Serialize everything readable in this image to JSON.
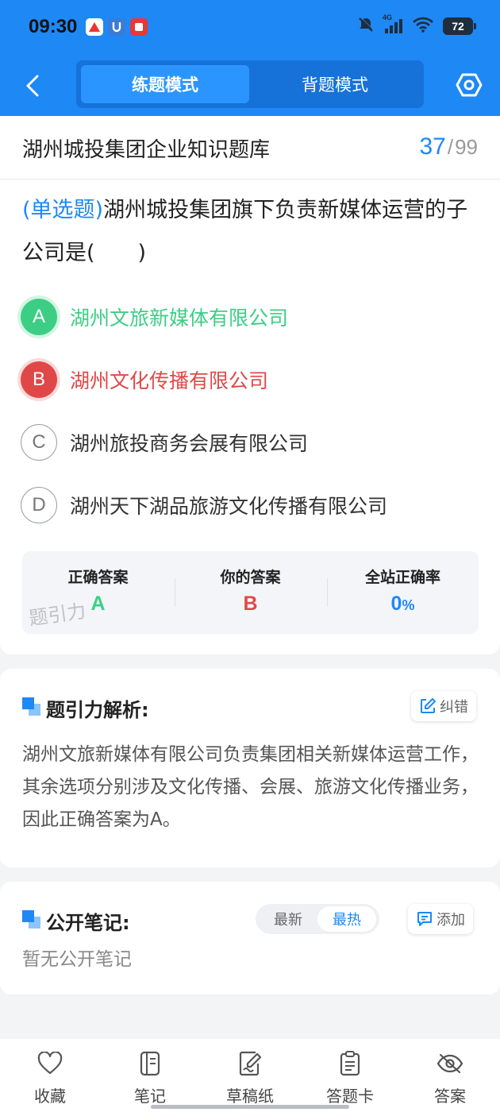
{
  "status_bar": {
    "time": "09:30",
    "network": "4G",
    "battery": "72"
  },
  "nav": {
    "mode_practice": "练题模式",
    "mode_memorize": "背题模式"
  },
  "bank": {
    "title": "湖州城投集团企业知识题库",
    "current": "37",
    "separator": "/",
    "total": "99"
  },
  "question": {
    "type": "(单选题)",
    "text": "湖州城投集团旗下负责新媒体运营的子公司是(　　)",
    "options": [
      {
        "letter": "A",
        "text": "湖州文旅新媒体有限公司",
        "state": "correct"
      },
      {
        "letter": "B",
        "text": "湖州文化传播有限公司",
        "state": "wrong"
      },
      {
        "letter": "C",
        "text": "湖州旅投商务会展有限公司",
        "state": "plain"
      },
      {
        "letter": "D",
        "text": "湖州天下湖品旅游文化传播有限公司",
        "state": "plain"
      }
    ]
  },
  "answer_panel": {
    "correct_label": "正确答案",
    "correct_value": "A",
    "yours_label": "你的答案",
    "yours_value": "B",
    "rate_label": "全站正确率",
    "rate_value": "0",
    "rate_unit": "%",
    "watermark": "题引力"
  },
  "analysis": {
    "title": "题引力解析:",
    "report_label": "纠错",
    "text": "湖州文旅新媒体有限公司负责集团相关新媒体运营工作，其余选项分别涉及文化传播、会展、旅游文化传播业务，因此正确答案为A。"
  },
  "notes": {
    "title": "公开笔记:",
    "sort_latest": "最新",
    "sort_hot": "最热",
    "add_label": "添加",
    "empty_text": "暂无公开笔记"
  },
  "toolbar": {
    "favorite": "收藏",
    "notes": "笔记",
    "scratch": "草稿纸",
    "answer_sheet": "答题卡",
    "answer": "答案"
  },
  "colors": {
    "primary": "#1e88f5",
    "correct": "#3dce85",
    "wrong": "#e04848"
  }
}
